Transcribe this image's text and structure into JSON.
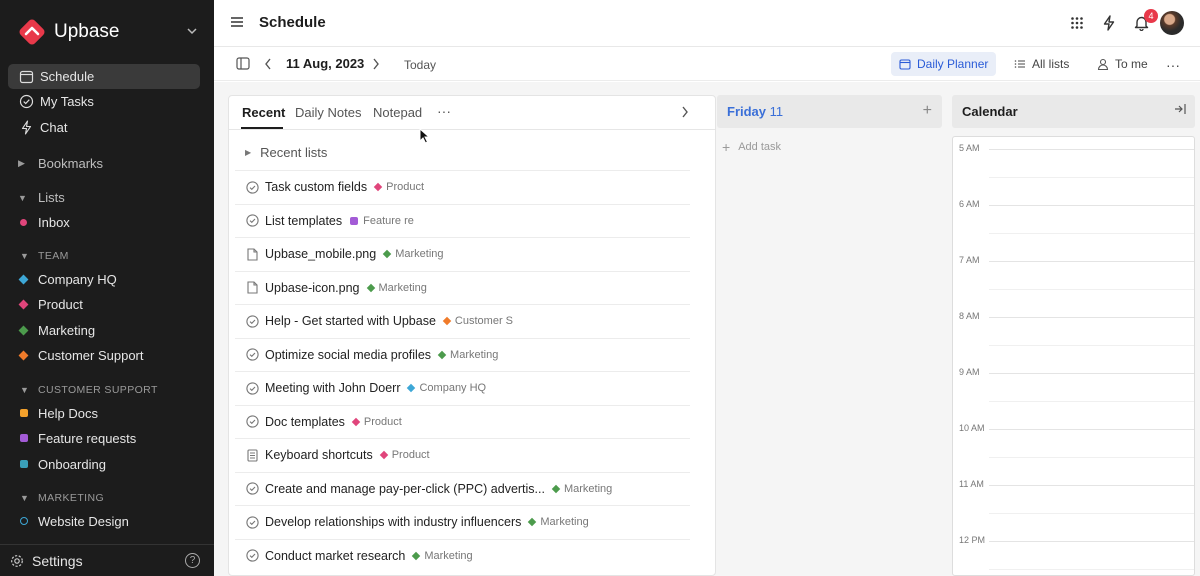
{
  "brand": {
    "name": "Upbase",
    "color": "#e8394a"
  },
  "sidebar": {
    "nav": [
      {
        "label": "Schedule",
        "icon": "calendar-icon",
        "active": true
      },
      {
        "label": "My Tasks",
        "icon": "check-circle-icon"
      },
      {
        "label": "Chat",
        "icon": "lightning-icon"
      }
    ],
    "bookmarks_label": "Bookmarks",
    "lists_label": "Lists",
    "inbox_label": "Inbox",
    "team_label": "TEAM",
    "team_items": [
      {
        "label": "Company HQ",
        "color": "#3da7d6",
        "shape": "diamond"
      },
      {
        "label": "Product",
        "color": "#e0457b",
        "shape": "diamond"
      },
      {
        "label": "Marketing",
        "color": "#4c9b4c",
        "shape": "diamond"
      },
      {
        "label": "Customer Support",
        "color": "#f07b2a",
        "shape": "diamond"
      }
    ],
    "cs_label": "CUSTOMER SUPPORT",
    "cs_items": [
      {
        "label": "Help Docs",
        "color": "#f3a12c"
      },
      {
        "label": "Feature requests",
        "color": "#a35bd6"
      },
      {
        "label": "Onboarding",
        "color": "#3a9fb8"
      }
    ],
    "marketing_label": "MARKETING",
    "marketing_items": [
      {
        "label": "Website Design",
        "color": "#3da7d6"
      }
    ],
    "settings_label": "Settings",
    "help_glyph": "?"
  },
  "topbar": {
    "title": "Schedule",
    "notification_count": "4"
  },
  "subbar": {
    "date": "11 Aug, 2023",
    "today_label": "Today",
    "daily_planner_label": "Daily Planner",
    "all_lists_label": "All lists",
    "to_me_label": "To me"
  },
  "panel": {
    "tabs": [
      "Recent",
      "Daily Notes",
      "Notepad"
    ],
    "more_glyph": "···",
    "recent_lists_label": "Recent lists",
    "rows": [
      {
        "name": "Task custom fields",
        "icon": "check-circle-icon",
        "tag": "Product",
        "tag_color": "#e0457b",
        "tag_shape": "diamond"
      },
      {
        "name": "List templates",
        "icon": "check-circle-icon",
        "tag": "Feature re",
        "tag_color": "#a35bd6",
        "tag_shape": "square"
      },
      {
        "name": "Upbase_mobile.png",
        "icon": "file-icon",
        "tag": "Marketing",
        "tag_color": "#4c9b4c",
        "tag_shape": "diamond"
      },
      {
        "name": "Upbase-icon.png",
        "icon": "file-icon",
        "tag": "Marketing",
        "tag_color": "#4c9b4c",
        "tag_shape": "diamond"
      },
      {
        "name": "Help - Get started with Upbase",
        "icon": "check-circle-icon",
        "tag": "Customer S",
        "tag_color": "#f07b2a",
        "tag_shape": "diamond"
      },
      {
        "name": "Optimize social media profiles",
        "icon": "check-circle-icon",
        "tag": "Marketing",
        "tag_color": "#4c9b4c",
        "tag_shape": "diamond"
      },
      {
        "name": "Meeting with John Doerr",
        "icon": "check-circle-icon",
        "tag": "Company HQ",
        "tag_color": "#3da7d6",
        "tag_shape": "diamond"
      },
      {
        "name": "Doc templates",
        "icon": "check-circle-icon",
        "tag": "Product",
        "tag_color": "#e0457b",
        "tag_shape": "diamond"
      },
      {
        "name": "Keyboard shortcuts",
        "icon": "doc-icon",
        "tag": "Product",
        "tag_color": "#e0457b",
        "tag_shape": "diamond"
      },
      {
        "name": "Create and manage pay-per-click (PPC) advertis...",
        "icon": "check-circle-icon",
        "tag": "Marketing",
        "tag_color": "#4c9b4c",
        "tag_shape": "diamond"
      },
      {
        "name": "Develop relationships with industry influencers",
        "icon": "check-circle-icon",
        "tag": "Marketing",
        "tag_color": "#4c9b4c",
        "tag_shape": "diamond"
      },
      {
        "name": "Conduct market research",
        "icon": "check-circle-icon",
        "tag": "Marketing",
        "tag_color": "#4c9b4c",
        "tag_shape": "diamond"
      }
    ]
  },
  "day": {
    "weekday": "Friday",
    "day_num": "11",
    "add_task_label": "Add task"
  },
  "calendar": {
    "title": "Calendar",
    "hours": [
      "5 AM",
      "6 AM",
      "7 AM",
      "8 AM",
      "9 AM",
      "10 AM",
      "11 AM",
      "12 PM"
    ]
  }
}
